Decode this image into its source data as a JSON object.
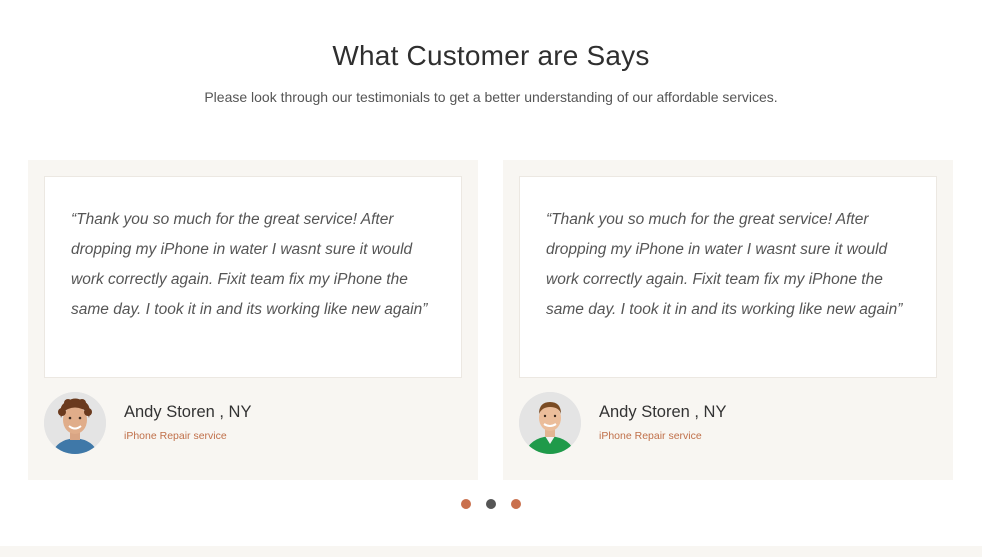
{
  "section": {
    "title": "What Customer are Says",
    "subtitle": "Please look through our testimonials to get a better understanding of our affordable services."
  },
  "testimonials": [
    {
      "quote": "“Thank you so much for the great service! After dropping my iPhone in water I wasnt sure it would work correctly again. Fixit team fix my iPhone the same day. I took it in and its working like new again”",
      "name": "Andy Storen , NY",
      "role": "iPhone Repair service",
      "avatar": "curly-hair-man-avatar"
    },
    {
      "quote": "“Thank you so much for the great service! After dropping my iPhone in water I wasnt sure it would work correctly again. Fixit team fix my iPhone the same day. I took it in and its working like new again”",
      "name": "Andy Storen , NY",
      "role": "iPhone Repair service",
      "avatar": "green-shirt-man-avatar"
    }
  ],
  "pagination": {
    "dots": [
      {
        "state": "inactive",
        "color": "#c9704d"
      },
      {
        "state": "active",
        "color": "#555555"
      },
      {
        "state": "inactive",
        "color": "#c9704d"
      }
    ]
  },
  "colors": {
    "accent": "#c0704a",
    "card_bg": "#f8f6f2",
    "heading": "#2f2f2f"
  }
}
